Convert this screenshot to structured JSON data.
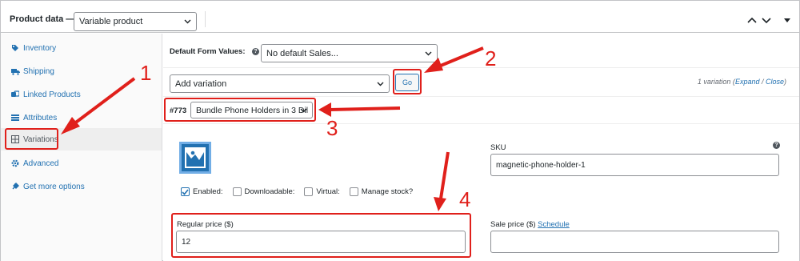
{
  "header": {
    "title": "Product data —",
    "product_type": "Variable product"
  },
  "sidebar": {
    "items": [
      {
        "label": "Inventory",
        "icon": "tag-icon"
      },
      {
        "label": "Shipping",
        "icon": "truck-icon"
      },
      {
        "label": "Linked Products",
        "icon": "link-icon"
      },
      {
        "label": "Attributes",
        "icon": "list-icon"
      },
      {
        "label": "Variations",
        "icon": "grid-icon",
        "active": true
      },
      {
        "label": "Advanced",
        "icon": "gear-icon"
      },
      {
        "label": "Get more options",
        "icon": "plug-icon"
      }
    ]
  },
  "defaults": {
    "label": "Default Form Values:",
    "value": "No default Sales..."
  },
  "add_variation": {
    "value": "Add variation",
    "go_label": "Go",
    "count_text": "1 variation (",
    "expand": "Expand",
    "slash": " / ",
    "close": "Close",
    "close_paren": ")"
  },
  "variation": {
    "number": "#773",
    "value": "Bundle Phone Holders in 3 Dil",
    "sku_label": "SKU",
    "sku_value": "magnetic-phone-holder-1",
    "options": {
      "enabled": "Enabled:",
      "downloadable": "Downloadable:",
      "virtual": "Virtual:",
      "manage_stock": "Manage stock?"
    },
    "regular_price_label": "Regular price ($)",
    "regular_price_value": "12",
    "sale_price_label": "Sale price ($)",
    "schedule_label": "Schedule",
    "sale_price_value": ""
  },
  "annotations": {
    "n1": "1",
    "n2": "2",
    "n3": "3",
    "n4": "4",
    "color": "#e0201b"
  },
  "colors": {
    "link": "#2271b1",
    "border": "#c3c4c7"
  }
}
